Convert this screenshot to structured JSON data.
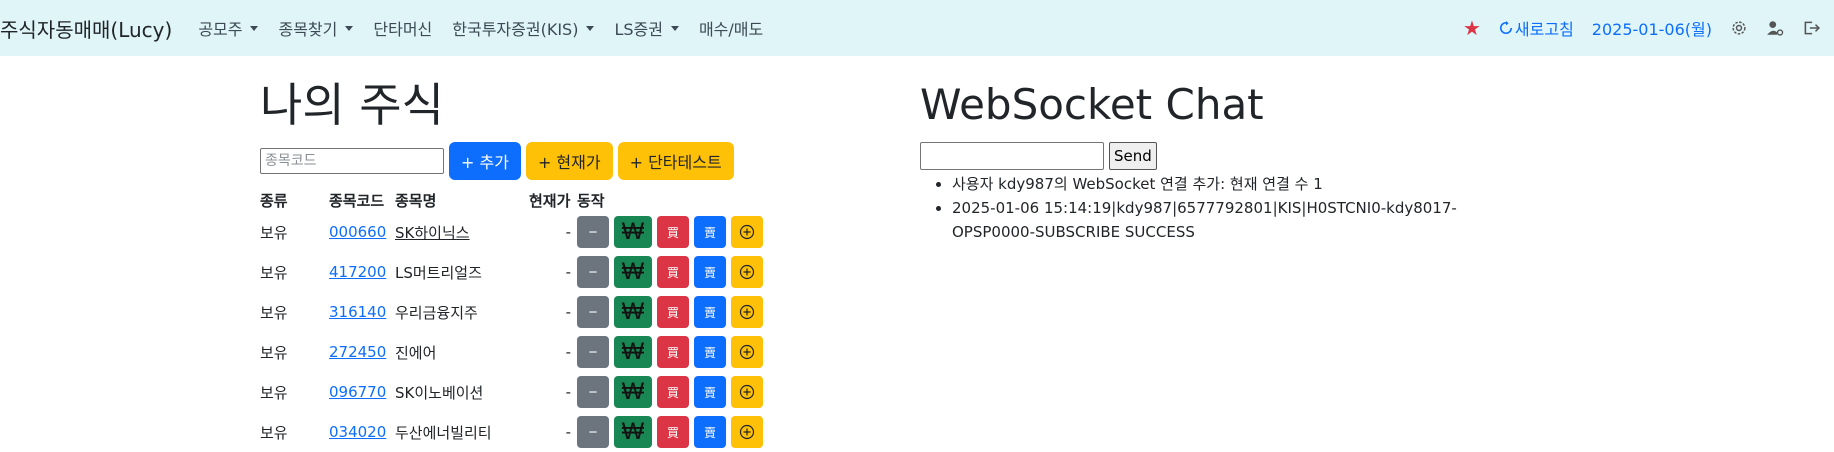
{
  "navbar": {
    "brand": "주식자동매매(Lucy)",
    "menu": [
      {
        "label": "공모주",
        "dropdown": true
      },
      {
        "label": "종목찾기",
        "dropdown": true
      },
      {
        "label": "단타머신",
        "dropdown": false
      },
      {
        "label": "한국투자증권(KIS)",
        "dropdown": true
      },
      {
        "label": "LS증권",
        "dropdown": true
      },
      {
        "label": "매수/매도",
        "dropdown": false
      }
    ],
    "refresh_label": "새로고침",
    "date_label": "2025-01-06(월)",
    "icons": [
      "star-icon",
      "refresh-icon",
      "gear-icon",
      "user-gear-icon",
      "logout-icon"
    ],
    "colors": {
      "navbar_bg": "#dff5f8",
      "accent": "#0d6efd",
      "star": "#dc3545"
    }
  },
  "portfolio": {
    "title": "나의 주식",
    "code_placeholder": "종목코드",
    "buttons": {
      "add": "+ 추가",
      "current_price": "+ 현재가",
      "scalp_test": "+ 단타테스트"
    },
    "columns": [
      "종류",
      "종목코드",
      "종목명",
      "현재가",
      "동작"
    ],
    "rows": [
      {
        "type": "보유",
        "code": "000660",
        "name": "SK하이닉스",
        "price": "-"
      },
      {
        "type": "보유",
        "code": "417200",
        "name": "LS머트리얼즈",
        "price": "-"
      },
      {
        "type": "보유",
        "code": "316140",
        "name": "우리금융지주",
        "price": "-"
      },
      {
        "type": "보유",
        "code": "272450",
        "name": "진에어",
        "price": "-"
      },
      {
        "type": "보유",
        "code": "096770",
        "name": "SK이노베이션",
        "price": "-"
      },
      {
        "type": "보유",
        "code": "034020",
        "name": "두산에너빌리티",
        "price": "-"
      }
    ],
    "action_labels": {
      "remove": "−",
      "won": "₩",
      "buy": "買",
      "sell": "賣",
      "plus": "⊕"
    },
    "action_colors": {
      "remove": "#6c757d",
      "won": "#198754",
      "buy": "#dc3545",
      "sell": "#0d6efd",
      "plus": "#ffc107"
    }
  },
  "chat": {
    "title": "WebSocket Chat",
    "send_label": "Send",
    "input_value": "",
    "messages": [
      "사용자 kdy987의 WebSocket 연결 추가: 현재 연결 수 1",
      "2025-01-06 15:14:19|kdy987|6577792801|KIS|H0STCNI0-kdy8017-OPSP0000-SUBSCRIBE SUCCESS"
    ]
  }
}
